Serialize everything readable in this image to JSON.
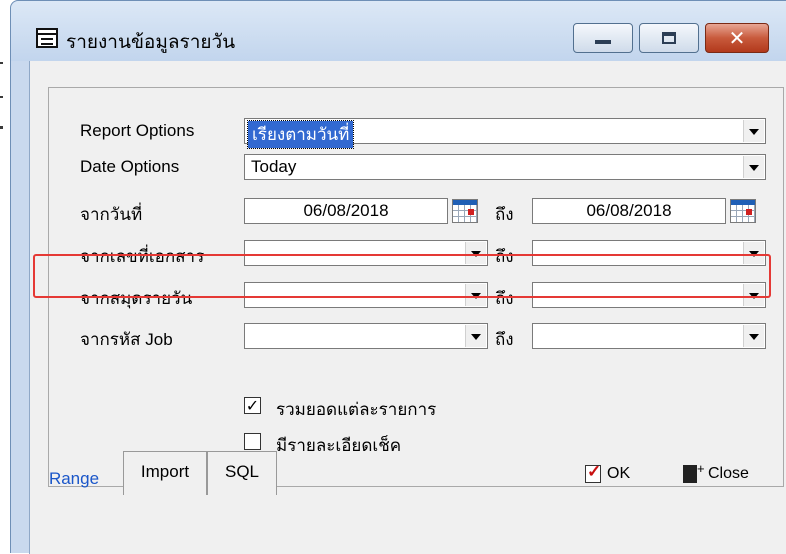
{
  "window": {
    "title": "รายงานข้อมูลรายวัน",
    "buttons": {
      "minimize": "",
      "maximize": "",
      "close": "✕"
    }
  },
  "form": {
    "report_options": {
      "label": "Report Options",
      "value": "เรียงตามวันที่"
    },
    "date_options": {
      "label": "Date Options",
      "value": "Today"
    },
    "from_date": {
      "label": "จากวันที่",
      "from": "06/08/2018",
      "to_label": "ถึง",
      "to": "06/08/2018"
    },
    "from_doc": {
      "label": "จากเลขที่เอกสาร",
      "to_label": "ถึง",
      "from": "",
      "to": ""
    },
    "from_book": {
      "label": "จากสมุดรายวัน",
      "to_label": "ถึง",
      "from": "",
      "to": ""
    },
    "from_job": {
      "label": "จากรหัส Job",
      "to_label": "ถึง",
      "from": "",
      "to": ""
    }
  },
  "checkboxes": {
    "sum_per_item": {
      "label": "รวมยอดแต่ละรายการ",
      "checked": true,
      "mark": "✓"
    },
    "cheque_detail": {
      "label": "มีรายละเอียดเช็ค",
      "checked": false
    }
  },
  "tabs": [
    {
      "label": "Range",
      "active": true
    },
    {
      "label": "Import",
      "active": false
    },
    {
      "label": "SQL",
      "active": false
    }
  ],
  "actions": {
    "ok": "OK",
    "close": "Close"
  },
  "colors": {
    "highlight": "#e53935",
    "selection": "#3269d1",
    "active_tab": "#1a56c9"
  }
}
